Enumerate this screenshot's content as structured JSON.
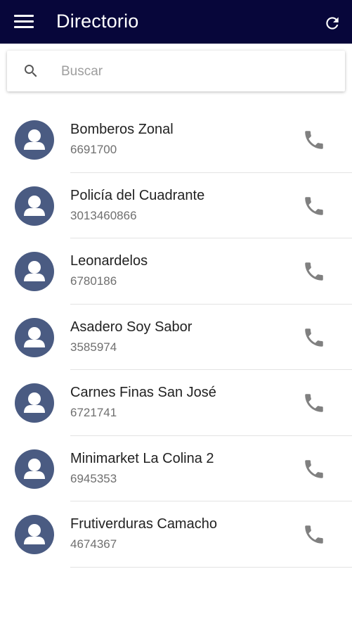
{
  "appbar": {
    "title": "Directorio",
    "menu_icon": "menu-icon",
    "refresh_icon": "refresh-icon",
    "background": "#07063a"
  },
  "search": {
    "placeholder": "Buscar",
    "value": "",
    "icon": "search-icon"
  },
  "contacts": [
    {
      "name": "Bomberos Zonal",
      "phone": "6691700"
    },
    {
      "name": "Policía del Cuadrante",
      "phone": "3013460866"
    },
    {
      "name": "Leonardelos",
      "phone": "6780186"
    },
    {
      "name": "Asadero Soy Sabor",
      "phone": "3585974"
    },
    {
      "name": "Carnes Finas San José",
      "phone": "6721741"
    },
    {
      "name": "Minimarket La Colina 2",
      "phone": "6945353"
    },
    {
      "name": "Frutiverduras Camacho",
      "phone": "4674367"
    }
  ],
  "colors": {
    "avatar": "#4a5b82",
    "call_icon": "#808080"
  }
}
